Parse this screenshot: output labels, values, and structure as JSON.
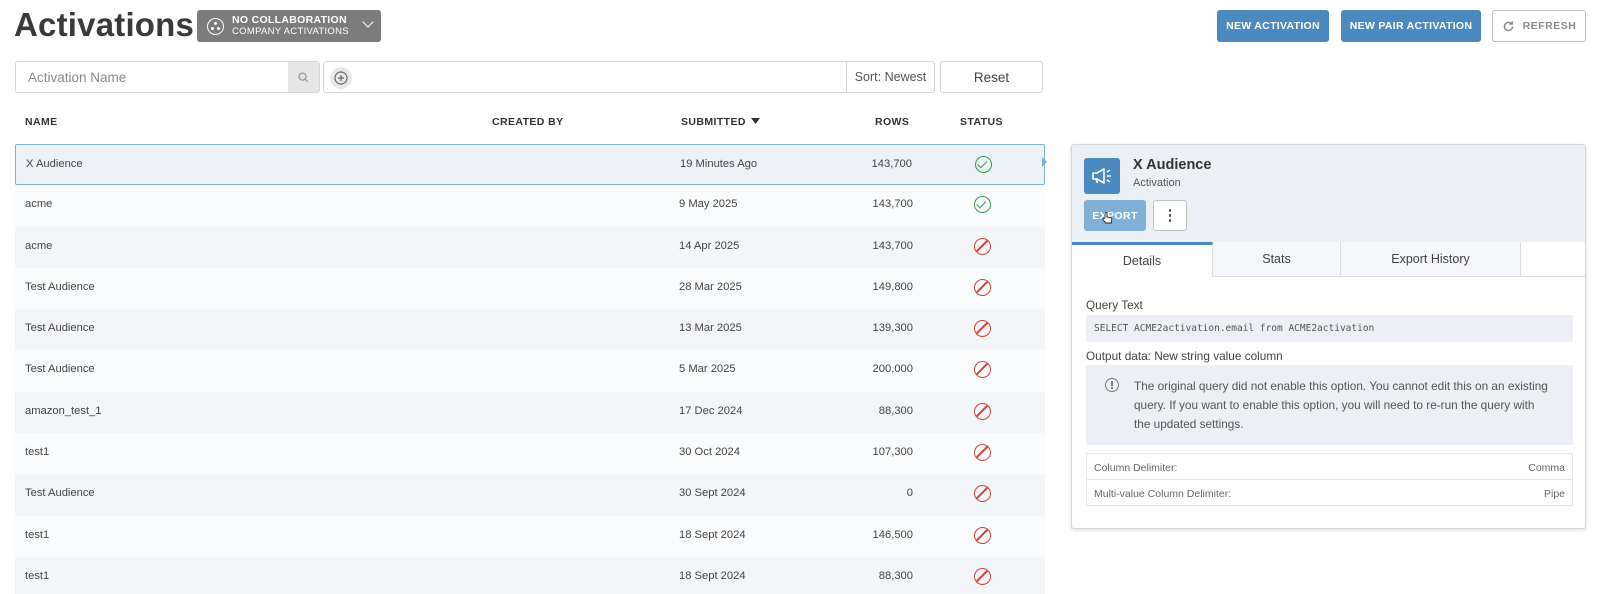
{
  "header": {
    "title": "Activations",
    "collab": {
      "line1": "NO COLLABORATION",
      "line2": "COMPANY ACTIVATIONS"
    },
    "new_activation": "NEW ACTIVATION",
    "new_pair_activation": "NEW PAIR ACTIVATION",
    "refresh": "REFRESH"
  },
  "filters": {
    "search_placeholder": "Activation Name",
    "sort": "Sort: Newest",
    "reset": "Reset"
  },
  "table": {
    "columns": {
      "name": "NAME",
      "created_by": "CREATED BY",
      "submitted": "SUBMITTED",
      "rows": "ROWS",
      "status": "STATUS"
    },
    "rows": [
      {
        "name": "X Audience",
        "created_by": "",
        "submitted": "19 Minutes Ago",
        "rows": "143,700",
        "status": "success"
      },
      {
        "name": "acme",
        "created_by": "",
        "submitted": "9 May 2025",
        "rows": "143,700",
        "status": "success"
      },
      {
        "name": "acme",
        "created_by": "",
        "submitted": "14 Apr 2025",
        "rows": "143,700",
        "status": "failed"
      },
      {
        "name": "Test Audience",
        "created_by": "",
        "submitted": "28 Mar 2025",
        "rows": "149,800",
        "status": "failed"
      },
      {
        "name": "Test Audience",
        "created_by": "",
        "submitted": "13 Mar 2025",
        "rows": "139,300",
        "status": "failed"
      },
      {
        "name": "Test Audience",
        "created_by": "",
        "submitted": "5 Mar 2025",
        "rows": "200,000",
        "status": "failed"
      },
      {
        "name": "amazon_test_1",
        "created_by": "",
        "submitted": "17 Dec 2024",
        "rows": "88,300",
        "status": "failed"
      },
      {
        "name": "test1",
        "created_by": "",
        "submitted": "30 Oct 2024",
        "rows": "107,300",
        "status": "failed"
      },
      {
        "name": "Test Audience",
        "created_by": "",
        "submitted": "30 Sept 2024",
        "rows": "0",
        "status": "failed"
      },
      {
        "name": "test1",
        "created_by": "",
        "submitted": "18 Sept 2024",
        "rows": "146,500",
        "status": "failed"
      },
      {
        "name": "test1",
        "created_by": "",
        "submitted": "18 Sept 2024",
        "rows": "88,300",
        "status": "failed"
      }
    ]
  },
  "panel": {
    "title": "X Audience",
    "subtitle": "Activation",
    "export": "EXPORT",
    "tabs": [
      "Details",
      "Stats",
      "Export History"
    ],
    "query_label": "Query Text",
    "query": "SELECT ACME2activation.email from ACME2activation",
    "output_label": "Output data: New string value column",
    "notice": "The original query did not enable this option. You cannot edit this on an existing query. If you want to enable this option, you will need to re-run the query with the updated settings.",
    "settings": [
      {
        "key": "Column Delimiter:",
        "value": "Comma"
      },
      {
        "key": "Multi-value Column Delimiter:",
        "value": "Pipe"
      }
    ]
  },
  "colors": {
    "accent": "#4a8ac0",
    "success": "#2f9e4f",
    "error": "#d0453a"
  }
}
